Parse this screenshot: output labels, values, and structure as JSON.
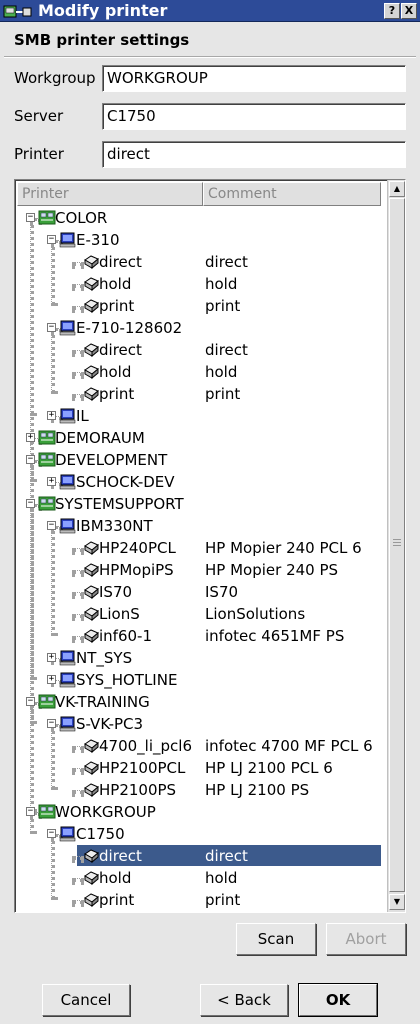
{
  "window": {
    "title": "Modify printer",
    "help_label": "?",
    "close_label": "X"
  },
  "group_title": "SMB printer settings",
  "fields": {
    "workgroup": {
      "label": "Workgroup",
      "value": "WORKGROUP"
    },
    "server": {
      "label": "Server",
      "value": "C1750"
    },
    "printer": {
      "label": "Printer",
      "value": "direct"
    }
  },
  "tree": {
    "columns": [
      "Printer",
      "Comment"
    ],
    "rows": [
      {
        "label": "COLOR",
        "comment": "",
        "depth": 0,
        "kind": "workgroup",
        "expander": "minus"
      },
      {
        "label": "E-310",
        "comment": "",
        "depth": 1,
        "kind": "server",
        "expander": "minus"
      },
      {
        "label": "direct",
        "comment": "direct",
        "depth": 2,
        "kind": "printer"
      },
      {
        "label": "hold",
        "comment": "hold",
        "depth": 2,
        "kind": "printer"
      },
      {
        "label": "print",
        "comment": "print",
        "depth": 2,
        "kind": "printer"
      },
      {
        "label": "E-710-128602",
        "comment": "",
        "depth": 1,
        "kind": "server",
        "expander": "minus"
      },
      {
        "label": "direct",
        "comment": "direct",
        "depth": 2,
        "kind": "printer"
      },
      {
        "label": "hold",
        "comment": "hold",
        "depth": 2,
        "kind": "printer"
      },
      {
        "label": "print",
        "comment": "print",
        "depth": 2,
        "kind": "printer"
      },
      {
        "label": "IL",
        "comment": "",
        "depth": 1,
        "kind": "server",
        "expander": "plus"
      },
      {
        "label": "DEMORAUM",
        "comment": "",
        "depth": 0,
        "kind": "workgroup",
        "expander": "plus"
      },
      {
        "label": "DEVELOPMENT",
        "comment": "",
        "depth": 0,
        "kind": "workgroup",
        "expander": "minus"
      },
      {
        "label": "SCHOCK-DEV",
        "comment": "",
        "depth": 1,
        "kind": "server",
        "expander": "plus"
      },
      {
        "label": "SYSTEMSUPPORT",
        "comment": "",
        "depth": 0,
        "kind": "workgroup",
        "expander": "minus"
      },
      {
        "label": "IBM330NT",
        "comment": "",
        "depth": 1,
        "kind": "server",
        "expander": "minus"
      },
      {
        "label": "HP240PCL",
        "comment": "HP Mopier 240 PCL 6",
        "depth": 2,
        "kind": "printer"
      },
      {
        "label": "HPMopiPS",
        "comment": "HP Mopier 240 PS",
        "depth": 2,
        "kind": "printer"
      },
      {
        "label": "IS70",
        "comment": "IS70",
        "depth": 2,
        "kind": "printer"
      },
      {
        "label": "LionS",
        "comment": "LionSolutions",
        "depth": 2,
        "kind": "printer"
      },
      {
        "label": "inf60-1",
        "comment": "infotec 4651MF PS",
        "depth": 2,
        "kind": "printer"
      },
      {
        "label": "NT_SYS",
        "comment": "",
        "depth": 1,
        "kind": "server",
        "expander": "plus"
      },
      {
        "label": "SYS_HOTLINE",
        "comment": "",
        "depth": 1,
        "kind": "server",
        "expander": "plus"
      },
      {
        "label": "VK-TRAINING",
        "comment": "",
        "depth": 0,
        "kind": "workgroup",
        "expander": "minus"
      },
      {
        "label": "S-VK-PC3",
        "comment": "",
        "depth": 1,
        "kind": "server",
        "expander": "minus"
      },
      {
        "label": "4700_li_pcl6",
        "comment": "infotec 4700 MF PCL 6",
        "depth": 2,
        "kind": "printer"
      },
      {
        "label": "HP2100PCL",
        "comment": "HP LJ 2100 PCL 6",
        "depth": 2,
        "kind": "printer"
      },
      {
        "label": "HP2100PS",
        "comment": "HP LJ 2100 PS",
        "depth": 2,
        "kind": "printer"
      },
      {
        "label": "WORKGROUP",
        "comment": "",
        "depth": 0,
        "kind": "workgroup",
        "expander": "minus"
      },
      {
        "label": "C1750",
        "comment": "",
        "depth": 1,
        "kind": "server",
        "expander": "minus"
      },
      {
        "label": "direct",
        "comment": "direct",
        "depth": 2,
        "kind": "printer",
        "selected": true
      },
      {
        "label": "hold",
        "comment": "hold",
        "depth": 2,
        "kind": "printer"
      },
      {
        "label": "print",
        "comment": "print",
        "depth": 2,
        "kind": "printer"
      }
    ]
  },
  "buttons": {
    "scan": "Scan",
    "abort": "Abort",
    "cancel": "Cancel",
    "back": "< Back",
    "ok": "OK"
  },
  "colors": {
    "titlebar": "#2d4b98",
    "selection": "#3c5a8c",
    "window": "#e6e6e6"
  }
}
